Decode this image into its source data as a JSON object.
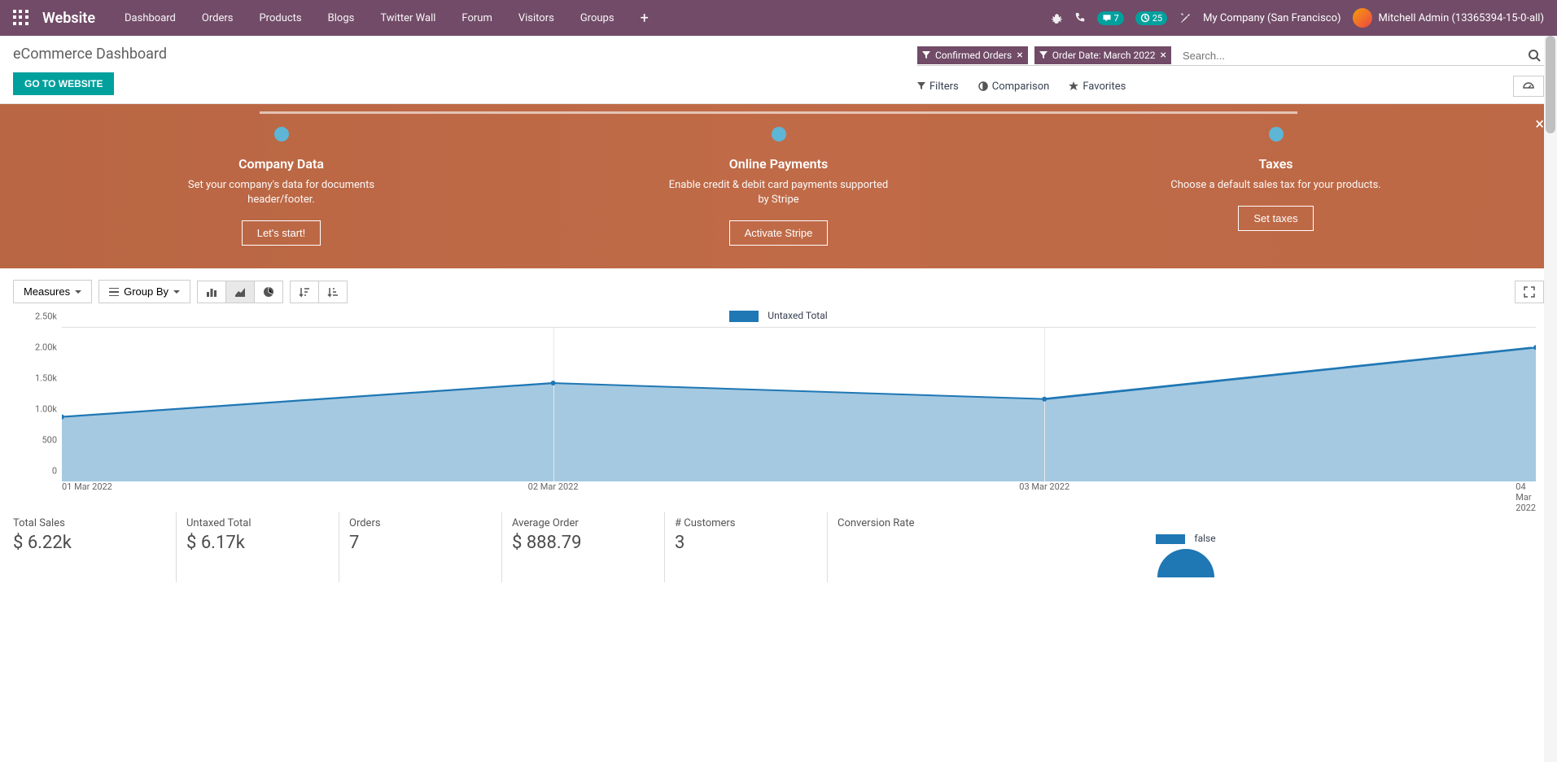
{
  "nav": {
    "brand": "Website",
    "items": [
      "Dashboard",
      "Orders",
      "Products",
      "Blogs",
      "Twitter Wall",
      "Forum",
      "Visitors",
      "Groups"
    ],
    "msg_badge": "7",
    "activity_badge": "25",
    "company": "My Company (San Francisco)",
    "user": "Mitchell Admin (13365394-15-0-all)"
  },
  "cp": {
    "title": "eCommerce Dashboard",
    "go_btn": "GO TO WEBSITE",
    "facets": [
      "Confirmed Orders",
      "Order Date: March 2022"
    ],
    "search_placeholder": "Search...",
    "filters": "Filters",
    "comparison": "Comparison",
    "favorites": "Favorites"
  },
  "onboard": {
    "steps": [
      {
        "title": "Company Data",
        "desc": "Set your company's data for documents header/footer.",
        "btn": "Let's start!"
      },
      {
        "title": "Online Payments",
        "desc": "Enable credit & debit card payments supported by Stripe",
        "btn": "Activate Stripe"
      },
      {
        "title": "Taxes",
        "desc": "Choose a default sales tax for your products.",
        "btn": "Set taxes"
      }
    ]
  },
  "toolbar": {
    "measures": "Measures",
    "groupby": "Group By"
  },
  "chart_data": {
    "type": "area",
    "title": "",
    "legend": "Untaxed Total",
    "xlabel": "",
    "ylabel": "",
    "ylim": [
      0,
      2500
    ],
    "y_ticks": [
      "0",
      "500",
      "1.00k",
      "1.50k",
      "2.00k",
      "2.50k"
    ],
    "categories": [
      "01 Mar 2022",
      "02 Mar 2022",
      "03 Mar 2022",
      "04 Mar 2022"
    ],
    "series": [
      {
        "name": "Untaxed Total",
        "values": [
          1050,
          1600,
          1340,
          2180
        ],
        "color": "#1f77b4"
      }
    ]
  },
  "stats": [
    {
      "label": "Total Sales",
      "value": "$ 6.22k"
    },
    {
      "label": "Untaxed Total",
      "value": "$ 6.17k"
    },
    {
      "label": "Orders",
      "value": "7"
    },
    {
      "label": "Average Order",
      "value": "$ 888.79"
    },
    {
      "label": "# Customers",
      "value": "3"
    }
  ],
  "conversion": {
    "label": "Conversion Rate",
    "pie_legend": "false"
  }
}
